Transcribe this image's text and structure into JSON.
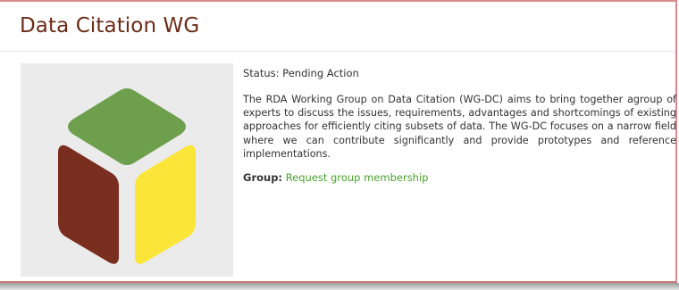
{
  "page": {
    "title": "Data Citation WG",
    "status": "Status: Pending Action",
    "description": "The RDA Working Group on Data Citation (WG-DC) aims to bring together agroup of experts to discuss the issues, requirements, advantages and shortcomings of existing approaches for efficiently citing subsets of data. The WG-DC focuses on a narrow field where we can contribute significantly and provide prototypes and reference implementations.",
    "group_label": "Group:",
    "group_link": "Request group membership"
  },
  "colors": {
    "title": "#6b2b17",
    "link": "#4aa12e",
    "logo_top": "#6e9f4d",
    "logo_left": "#7a2e1f",
    "logo_right": "#fbe538",
    "logo_bg": "#ebebeb"
  },
  "icons": {
    "logo": "rda-cube-logo-icon"
  }
}
